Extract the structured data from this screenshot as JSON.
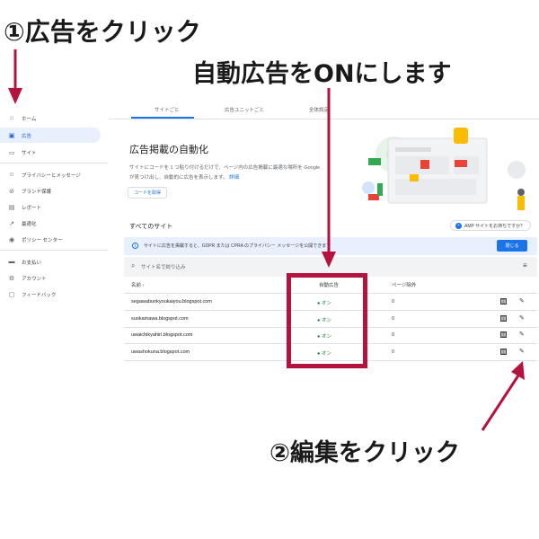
{
  "annotations": {
    "step1": "①広告をクリック",
    "step_on": "自動広告をONにします",
    "step2": "②編集をクリック"
  },
  "sidebar": {
    "items": [
      {
        "label": "ホーム",
        "icon": "home-icon"
      },
      {
        "label": "広告",
        "icon": "ads-icon"
      },
      {
        "label": "サイト",
        "icon": "sites-icon"
      },
      {
        "label": "プライバシーとメッセージ",
        "icon": "privacy-icon"
      },
      {
        "label": "ブランド保護",
        "icon": "block-icon"
      },
      {
        "label": "レポート",
        "icon": "reports-icon"
      },
      {
        "label": "最適化",
        "icon": "trend-icon"
      },
      {
        "label": "ポリシー センター",
        "icon": "policy-icon"
      },
      {
        "label": "お支払い",
        "icon": "payments-icon"
      },
      {
        "label": "アカウント",
        "icon": "settings-icon"
      },
      {
        "label": "フィードバック",
        "icon": "feedback-icon"
      }
    ]
  },
  "tabs": [
    "サイトごと",
    "広告ユニットごと",
    "全体設定"
  ],
  "headline": {
    "title": "広告掲載の自動化",
    "desc_line1": "サイトにコードを 1 つ貼り付けるだけで、ページ内の広告掲載に最適な場所を Google",
    "desc_line2": "が見つけ出し、自動的に広告を表示します。",
    "link": "詳細",
    "code_button": "コードを取得"
  },
  "all_sites": {
    "title": "すべてのサイト",
    "amp_chip": "AMP サイトをお持ちですか？"
  },
  "banner": {
    "text": "サイトに広告を掲載すると、GDPR または CPRA のプライバシー メッセージを公開できます",
    "button": "閉じる"
  },
  "filter": {
    "placeholder": "サイト名で絞り込み"
  },
  "table": {
    "headers": [
      "名前 ↑",
      "自動広告",
      "ページ除外"
    ],
    "rows": [
      {
        "site": "segawabunkyoukaiyou.blogspot.com",
        "auto_ads": "オン",
        "exclusions": "0"
      },
      {
        "site": "suokamawa.blogspot.com",
        "auto_ads": "オン",
        "exclusions": "0"
      },
      {
        "site": "uwaichikyahiri.blogspot.com",
        "auto_ads": "オン",
        "exclusions": "0"
      },
      {
        "site": "uwashokuna.blogspot.com",
        "auto_ads": "オン",
        "exclusions": "0"
      }
    ]
  },
  "colors": {
    "accent": "#1a73e8",
    "annotation_red": "#b5123e",
    "on_green": "#188038"
  }
}
